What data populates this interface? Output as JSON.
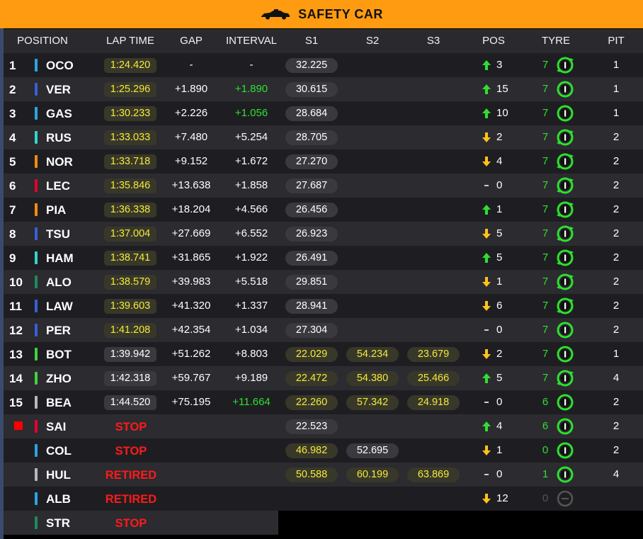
{
  "banner": {
    "title": "SAFETY CAR",
    "icon": "safety-car-icon",
    "color": "#ff9b10"
  },
  "colors": {
    "lap_highlight": "#f4e93a",
    "interval_green": "#2ee02e",
    "status_red": "#ff1a1a",
    "arrow_up": "#2ee02e",
    "arrow_down": "#ffc21a",
    "tyre_green": "#2ee02e"
  },
  "columns": {
    "position": "POSITION",
    "lap_time": "LAP TIME",
    "gap": "GAP",
    "interval": "INTERVAL",
    "s1": "S1",
    "s2": "S2",
    "s3": "S3",
    "pos": "POS",
    "tyre": "TYRE",
    "pit": "PIT"
  },
  "rows": [
    {
      "pos": "1",
      "driver": "OCO",
      "team_color": "#2aa6e0",
      "lap": "1:24.420",
      "lap_hl": true,
      "gap": "-",
      "interval": "-",
      "interval_green": false,
      "s1": "32.225",
      "s1_hl": false,
      "s2": "",
      "s2_hl": false,
      "s3": "",
      "s3_hl": false,
      "change_dir": "up",
      "change": "3",
      "tyre_age": "7",
      "tyre_icon": "tyre-recycle-icon",
      "pit": "1"
    },
    {
      "pos": "2",
      "driver": "VER",
      "team_color": "#3a5fd6",
      "lap": "1:25.296",
      "lap_hl": true,
      "gap": "+1.890",
      "interval": "+1.890",
      "interval_green": true,
      "s1": "30.615",
      "s1_hl": false,
      "s2": "",
      "s2_hl": false,
      "s3": "",
      "s3_hl": false,
      "change_dir": "up",
      "change": "15",
      "tyre_age": "7",
      "tyre_icon": "tyre-hard-icon",
      "pit": "1"
    },
    {
      "pos": "3",
      "driver": "GAS",
      "team_color": "#2aa6e0",
      "lap": "1:30.233",
      "lap_hl": true,
      "gap": "+2.226",
      "interval": "+1.056",
      "interval_green": true,
      "s1": "28.684",
      "s1_hl": false,
      "s2": "",
      "s2_hl": false,
      "s3": "",
      "s3_hl": false,
      "change_dir": "up",
      "change": "10",
      "tyre_age": "7",
      "tyre_icon": "tyre-hard-icon",
      "pit": "1"
    },
    {
      "pos": "4",
      "driver": "RUS",
      "team_color": "#33d6c8",
      "lap": "1:33.033",
      "lap_hl": true,
      "gap": "+7.480",
      "interval": "+5.254",
      "interval_green": false,
      "s1": "28.705",
      "s1_hl": false,
      "s2": "",
      "s2_hl": false,
      "s3": "",
      "s3_hl": false,
      "change_dir": "down",
      "change": "2",
      "tyre_age": "7",
      "tyre_icon": "tyre-recycle-icon",
      "pit": "2"
    },
    {
      "pos": "5",
      "driver": "NOR",
      "team_color": "#ff8a10",
      "lap": "1:33.718",
      "lap_hl": true,
      "gap": "+9.152",
      "interval": "+1.672",
      "interval_green": false,
      "s1": "27.270",
      "s1_hl": false,
      "s2": "",
      "s2_hl": false,
      "s3": "",
      "s3_hl": false,
      "change_dir": "down",
      "change": "4",
      "tyre_age": "7",
      "tyre_icon": "tyre-recycle-icon",
      "pit": "2"
    },
    {
      "pos": "6",
      "driver": "LEC",
      "team_color": "#e8002d",
      "lap": "1:35.846",
      "lap_hl": true,
      "gap": "+13.638",
      "interval": "+1.858",
      "interval_green": false,
      "s1": "27.687",
      "s1_hl": false,
      "s2": "",
      "s2_hl": false,
      "s3": "",
      "s3_hl": false,
      "change_dir": "none",
      "change": "0",
      "tyre_age": "7",
      "tyre_icon": "tyre-recycle-icon",
      "pit": "2"
    },
    {
      "pos": "7",
      "driver": "PIA",
      "team_color": "#ff8a10",
      "lap": "1:36.338",
      "lap_hl": true,
      "gap": "+18.204",
      "interval": "+4.566",
      "interval_green": false,
      "s1": "26.456",
      "s1_hl": false,
      "s2": "",
      "s2_hl": false,
      "s3": "",
      "s3_hl": false,
      "change_dir": "up",
      "change": "1",
      "tyre_age": "7",
      "tyre_icon": "tyre-recycle-icon",
      "pit": "2"
    },
    {
      "pos": "8",
      "driver": "TSU",
      "team_color": "#3a5fd6",
      "lap": "1:37.004",
      "lap_hl": true,
      "gap": "+27.669",
      "interval": "+6.552",
      "interval_green": false,
      "s1": "26.923",
      "s1_hl": false,
      "s2": "",
      "s2_hl": false,
      "s3": "",
      "s3_hl": false,
      "change_dir": "down",
      "change": "5",
      "tyre_age": "7",
      "tyre_icon": "tyre-recycle-icon",
      "pit": "2"
    },
    {
      "pos": "9",
      "driver": "HAM",
      "team_color": "#33d6c8",
      "lap": "1:38.741",
      "lap_hl": true,
      "gap": "+31.865",
      "interval": "+1.922",
      "interval_green": false,
      "s1": "26.491",
      "s1_hl": false,
      "s2": "",
      "s2_hl": false,
      "s3": "",
      "s3_hl": false,
      "change_dir": "up",
      "change": "5",
      "tyre_age": "7",
      "tyre_icon": "tyre-recycle-icon",
      "pit": "2"
    },
    {
      "pos": "10",
      "driver": "ALO",
      "team_color": "#1e8a5e",
      "lap": "1:38.579",
      "lap_hl": true,
      "gap": "+39.983",
      "interval": "+5.518",
      "interval_green": false,
      "s1": "29.851",
      "s1_hl": false,
      "s2": "",
      "s2_hl": false,
      "s3": "",
      "s3_hl": false,
      "change_dir": "down",
      "change": "1",
      "tyre_age": "7",
      "tyre_icon": "tyre-recycle-icon",
      "pit": "2"
    },
    {
      "pos": "11",
      "driver": "LAW",
      "team_color": "#3a5fd6",
      "lap": "1:39.603",
      "lap_hl": true,
      "gap": "+41.320",
      "interval": "+1.337",
      "interval_green": false,
      "s1": "28.941",
      "s1_hl": false,
      "s2": "",
      "s2_hl": false,
      "s3": "",
      "s3_hl": false,
      "change_dir": "down",
      "change": "6",
      "tyre_age": "7",
      "tyre_icon": "tyre-recycle-icon",
      "pit": "2"
    },
    {
      "pos": "12",
      "driver": "PER",
      "team_color": "#3a5fd6",
      "lap": "1:41.208",
      "lap_hl": true,
      "gap": "+42.354",
      "interval": "+1.034",
      "interval_green": false,
      "s1": "27.304",
      "s1_hl": false,
      "s2": "",
      "s2_hl": false,
      "s3": "",
      "s3_hl": false,
      "change_dir": "none",
      "change": "0",
      "tyre_age": "7",
      "tyre_icon": "tyre-hard-icon",
      "pit": "2"
    },
    {
      "pos": "13",
      "driver": "BOT",
      "team_color": "#42d23c",
      "lap": "1:39.942",
      "lap_hl": false,
      "gap": "+51.262",
      "interval": "+8.803",
      "interval_green": false,
      "s1": "22.029",
      "s1_hl": true,
      "s2": "54.234",
      "s2_hl": true,
      "s3": "23.679",
      "s3_hl": true,
      "change_dir": "down",
      "change": "2",
      "tyre_age": "7",
      "tyre_icon": "tyre-hard-icon",
      "pit": "1"
    },
    {
      "pos": "14",
      "driver": "ZHO",
      "team_color": "#42d23c",
      "lap": "1:42.318",
      "lap_hl": false,
      "gap": "+59.767",
      "interval": "+9.189",
      "interval_green": false,
      "s1": "22.472",
      "s1_hl": true,
      "s2": "54.380",
      "s2_hl": true,
      "s3": "25.466",
      "s3_hl": true,
      "change_dir": "up",
      "change": "5",
      "tyre_age": "7",
      "tyre_icon": "tyre-recycle-icon",
      "pit": "4"
    },
    {
      "pos": "15",
      "driver": "BEA",
      "team_color": "#b6babd",
      "lap": "1:44.520",
      "lap_hl": false,
      "gap": "+75.195",
      "interval": "+11.664",
      "interval_green": true,
      "s1": "22.260",
      "s1_hl": true,
      "s2": "57.342",
      "s2_hl": true,
      "s3": "24.918",
      "s3_hl": true,
      "change_dir": "none",
      "change": "0",
      "tyre_age": "6",
      "tyre_icon": "tyre-hard-icon",
      "pit": "2"
    },
    {
      "pos": "",
      "driver": "SAI",
      "team_color": "#e8002d",
      "flag": true,
      "status": "STOP",
      "gap": "",
      "interval": "",
      "interval_green": false,
      "s1": "22.523",
      "s1_hl": false,
      "s2": "",
      "s2_hl": false,
      "s3": "",
      "s3_hl": false,
      "change_dir": "up",
      "change": "4",
      "tyre_age": "6",
      "tyre_icon": "tyre-hard-icon",
      "pit": "2"
    },
    {
      "pos": "",
      "driver": "COL",
      "team_color": "#2aa6e0",
      "status": "STOP",
      "gap": "",
      "interval": "",
      "interval_green": false,
      "s1": "46.982",
      "s1_hl": true,
      "s2": "52.695",
      "s2_hl": false,
      "s3": "",
      "s3_hl": false,
      "change_dir": "down",
      "change": "1",
      "tyre_age": "0",
      "tyre_icon": "tyre-hard-icon",
      "pit": "2"
    },
    {
      "pos": "",
      "driver": "HUL",
      "team_color": "#b6babd",
      "status": "RETIRED",
      "gap": "",
      "interval": "",
      "interval_green": false,
      "s1": "50.588",
      "s1_hl": true,
      "s2": "60.199",
      "s2_hl": true,
      "s3": "63.869",
      "s3_hl": true,
      "change_dir": "none",
      "change": "0",
      "tyre_age": "1",
      "tyre_icon": "tyre-hard-icon",
      "pit": "4"
    },
    {
      "pos": "",
      "driver": "ALB",
      "team_color": "#2aa6e0",
      "status": "RETIRED",
      "gap": "",
      "interval": "",
      "interval_green": false,
      "s1": "",
      "s1_hl": false,
      "s2": "",
      "s2_hl": false,
      "s3": "",
      "s3_hl": false,
      "change_dir": "down",
      "change": "12",
      "tyre_age": "0",
      "tyre_icon": "tyre-unknown-icon",
      "pit": ""
    },
    {
      "pos": "",
      "driver": "STR",
      "team_color": "#1e8a5e",
      "status": "STOP",
      "gap": "",
      "interval": "",
      "interval_green": false,
      "s1": "",
      "s1_hl": false,
      "s2": "",
      "s2_hl": false,
      "s3": "",
      "s3_hl": false,
      "change_dir": "",
      "change": "",
      "tyre_age": "",
      "tyre_icon": "",
      "pit": "",
      "half": true
    }
  ]
}
